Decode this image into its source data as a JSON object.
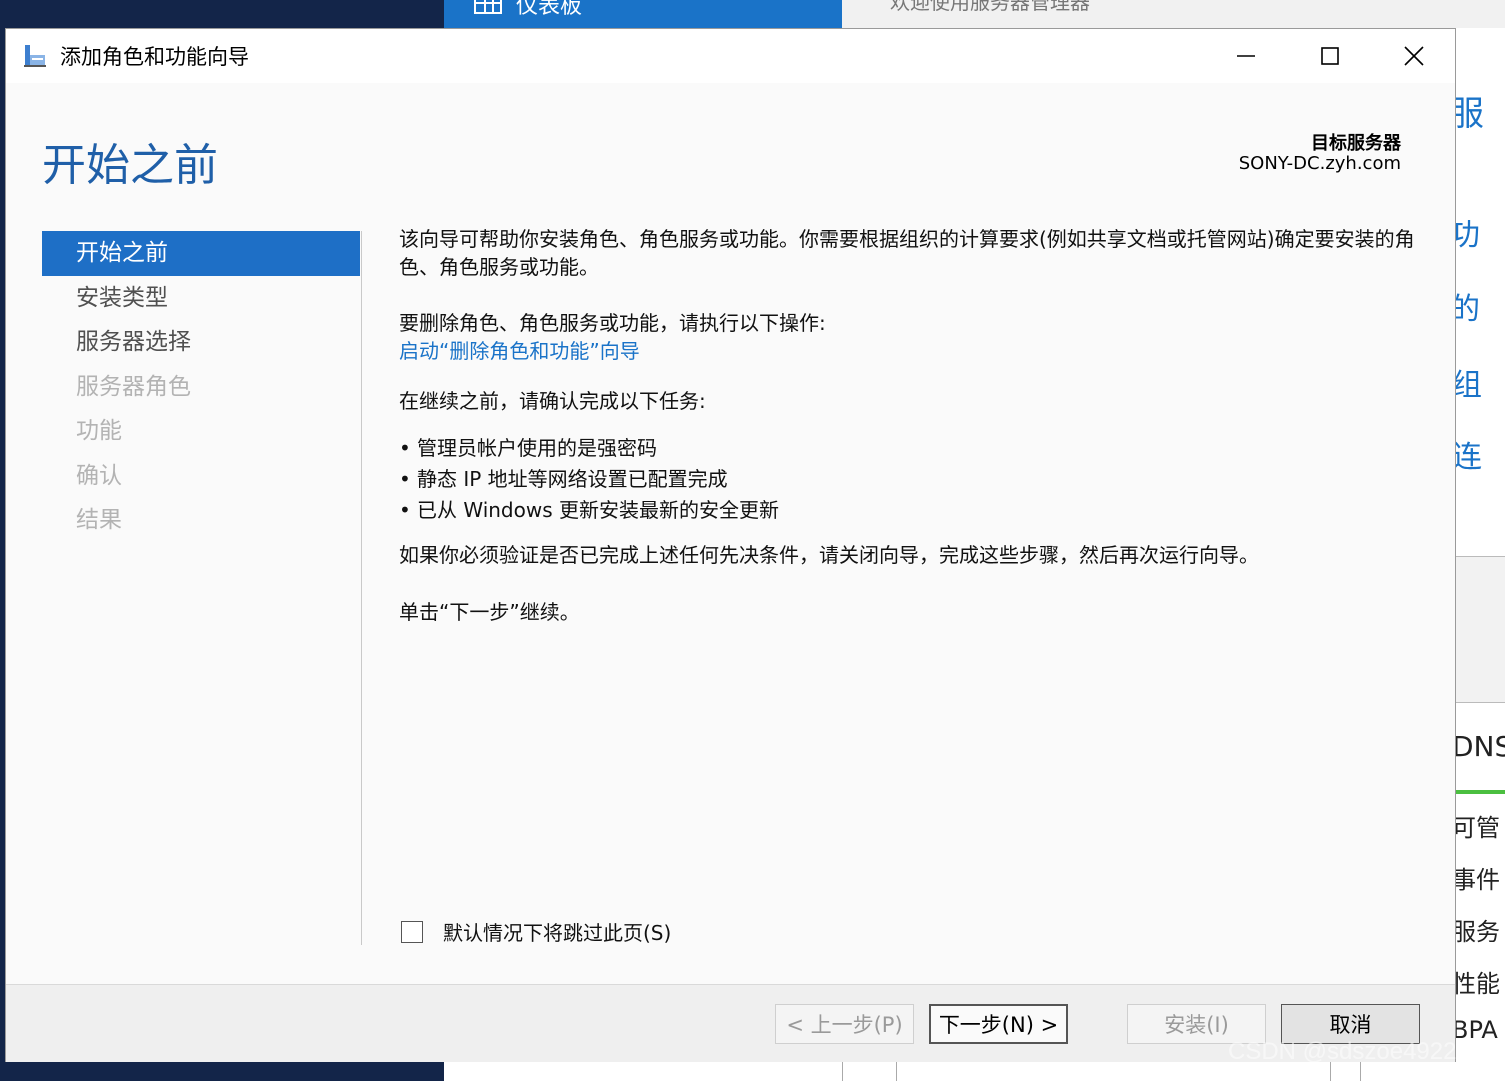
{
  "background": {
    "tab_label": "仪表板",
    "top_right_text": "欢迎使用服务器管理器",
    "right_fragments": [
      "服",
      "功",
      "的",
      "组",
      "连",
      "DNS",
      "可管",
      "事件",
      "服务",
      "性能",
      "BPA"
    ]
  },
  "window": {
    "title": "添加角色和功能向导"
  },
  "header": {
    "page_title": "开始之前",
    "target_label": "目标服务器",
    "target_value": "SONY-DC.zyh.com"
  },
  "nav": {
    "items": [
      {
        "label": "开始之前",
        "state": "active"
      },
      {
        "label": "安装类型",
        "state": "enabled"
      },
      {
        "label": "服务器选择",
        "state": "enabled"
      },
      {
        "label": "服务器角色",
        "state": "disabled"
      },
      {
        "label": "功能",
        "state": "disabled"
      },
      {
        "label": "确认",
        "state": "disabled"
      },
      {
        "label": "结果",
        "state": "disabled"
      }
    ]
  },
  "content": {
    "intro": "该向导可帮助你安装角色、角色服务或功能。你需要根据组织的计算要求(例如共享文档或托管网站)确定要安装的角色、角色服务或功能。",
    "remove_heading": "要删除角色、角色服务或功能，请执行以下操作:",
    "remove_link": "启动“删除角色和功能”向导",
    "confirm_heading": "在继续之前，请确认完成以下任务:",
    "tasks": [
      "管理员帐户使用的是强密码",
      "静态 IP 地址等网络设置已配置完成",
      "已从 Windows 更新安装最新的安全更新"
    ],
    "verify_note": "如果你必须验证是否已完成上述任何先决条件，请关闭向导，完成这些步骤，然后再次运行向导。",
    "continue_note": "单击“下一步”继续。",
    "skip_label": "默认情况下将跳过此页(S)"
  },
  "footer": {
    "prev_label": "< 上一步(P)",
    "next_label": "下一步(N) >",
    "install_label": "安装(I)",
    "cancel_label": "取消"
  },
  "watermark": "CSDN @sdszoe4922"
}
